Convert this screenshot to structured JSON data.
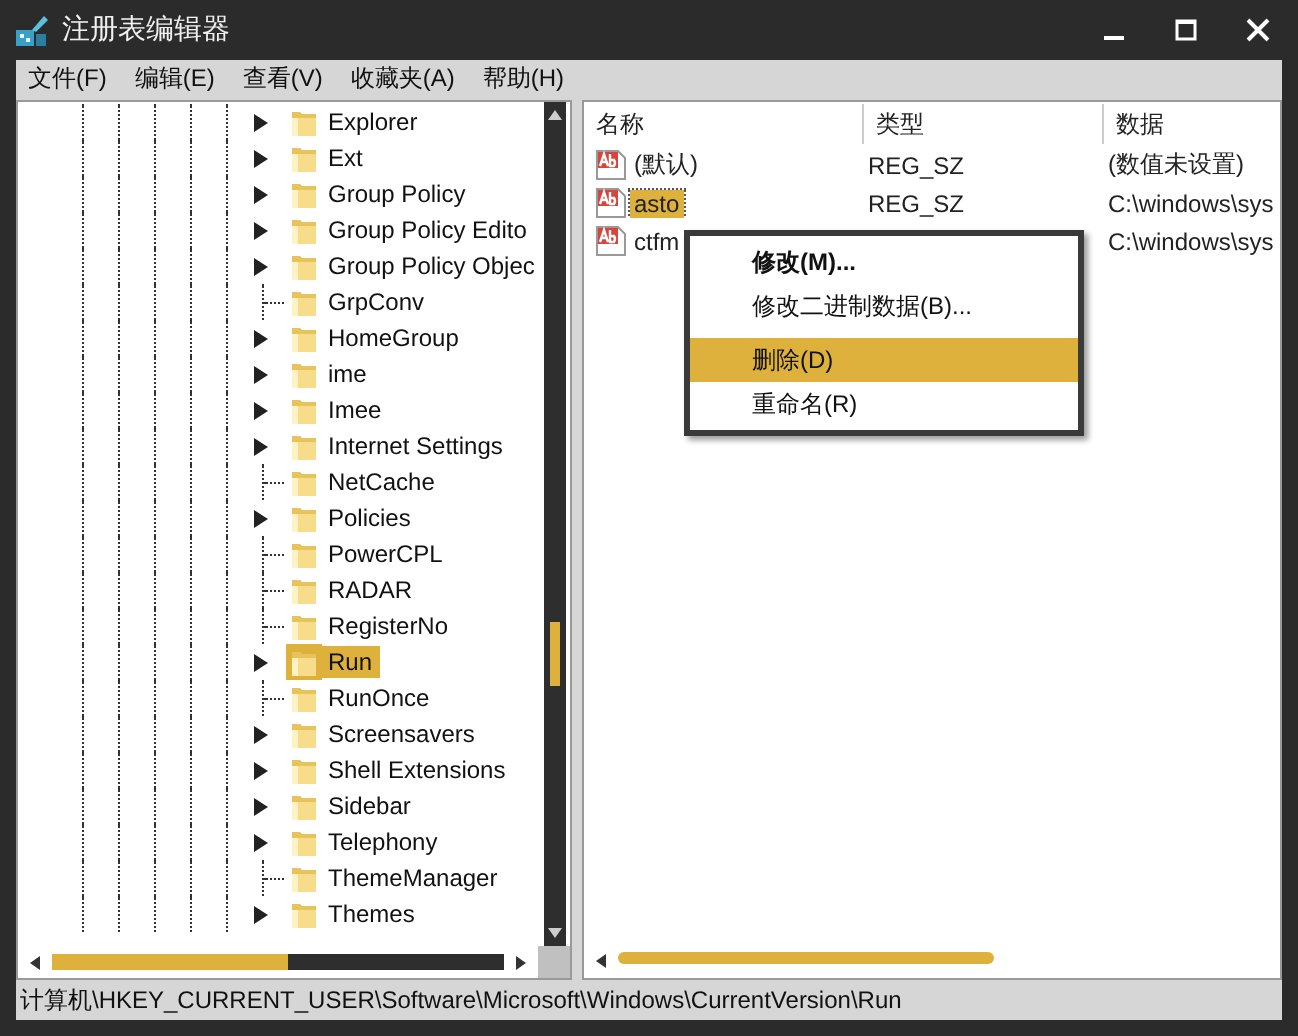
{
  "window": {
    "title": "注册表编辑器"
  },
  "menu": [
    "文件(F)",
    "编辑(E)",
    "查看(V)",
    "收藏夹(A)",
    "帮助(H)"
  ],
  "tree": {
    "items": [
      {
        "label": "Explorer",
        "has_children": true,
        "selected": false
      },
      {
        "label": "Ext",
        "has_children": true,
        "selected": false
      },
      {
        "label": "Group Policy",
        "has_children": true,
        "selected": false
      },
      {
        "label": "Group Policy Edito",
        "has_children": true,
        "selected": false
      },
      {
        "label": "Group Policy Objec",
        "has_children": true,
        "selected": false
      },
      {
        "label": "GrpConv",
        "has_children": false,
        "selected": false
      },
      {
        "label": "HomeGroup",
        "has_children": true,
        "selected": false
      },
      {
        "label": "ime",
        "has_children": true,
        "selected": false
      },
      {
        "label": "Imee",
        "has_children": true,
        "selected": false
      },
      {
        "label": "Internet Settings",
        "has_children": true,
        "selected": false
      },
      {
        "label": "NetCache",
        "has_children": false,
        "selected": false
      },
      {
        "label": "Policies",
        "has_children": true,
        "selected": false
      },
      {
        "label": "PowerCPL",
        "has_children": false,
        "selected": false
      },
      {
        "label": "RADAR",
        "has_children": false,
        "selected": false
      },
      {
        "label": "RegisterNo",
        "has_children": false,
        "selected": false
      },
      {
        "label": "Run",
        "has_children": true,
        "selected": true
      },
      {
        "label": "RunOnce",
        "has_children": false,
        "selected": false
      },
      {
        "label": "Screensavers",
        "has_children": true,
        "selected": false
      },
      {
        "label": "Shell Extensions",
        "has_children": true,
        "selected": false
      },
      {
        "label": "Sidebar",
        "has_children": true,
        "selected": false
      },
      {
        "label": "Telephony",
        "has_children": true,
        "selected": false
      },
      {
        "label": "ThemeManager",
        "has_children": false,
        "selected": false
      },
      {
        "label": "Themes",
        "has_children": true,
        "selected": false
      }
    ]
  },
  "values": {
    "columns": [
      "名称",
      "类型",
      "数据"
    ],
    "rows": [
      {
        "name": "(默认)",
        "type": "REG_SZ",
        "data": "(数值未设置)",
        "selected": false
      },
      {
        "name": "asto",
        "type": "REG_SZ",
        "data": "C:\\windows\\sys",
        "selected": true
      },
      {
        "name": "ctfm",
        "data": "C:\\windows\\sys",
        "selected": false
      }
    ]
  },
  "context_menu": [
    {
      "label": "修改(M)...",
      "bold": true,
      "separator_before": false,
      "selected": false
    },
    {
      "label": "修改二进制数据(B)...",
      "bold": false,
      "separator_before": false,
      "selected": false
    },
    {
      "label": "删除(D)",
      "bold": false,
      "separator_before": true,
      "selected": true
    },
    {
      "label": "重命名(R)",
      "bold": false,
      "separator_before": false,
      "selected": false
    }
  ],
  "status_bar": "计算机\\HKEY_CURRENT_USER\\Software\\Microsoft\\Windows\\CurrentVersion\\Run"
}
